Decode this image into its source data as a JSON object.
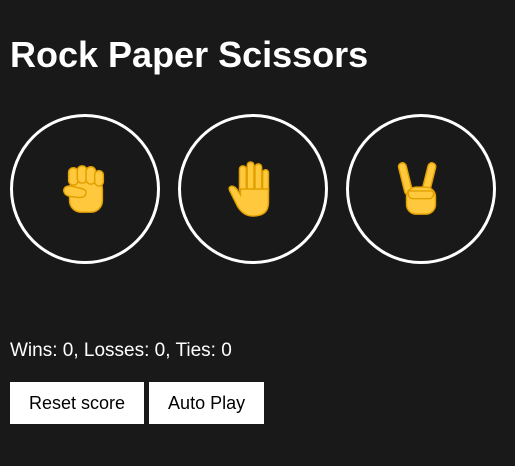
{
  "title": "Rock Paper Scissors",
  "moves": [
    {
      "name": "rock",
      "icon": "raised-fist-icon"
    },
    {
      "name": "paper",
      "icon": "raised-hand-icon"
    },
    {
      "name": "scissors",
      "icon": "victory-hand-icon"
    }
  ],
  "score_text": "Wins: 0, Losses: 0, Ties: 0",
  "controls": {
    "reset_label": "Reset score",
    "autoplay_label": "Auto Play"
  },
  "colors": {
    "background": "#191919",
    "text": "#ffffff",
    "emoji_skin": "#FFC83D",
    "emoji_outline": "#E0A000"
  }
}
